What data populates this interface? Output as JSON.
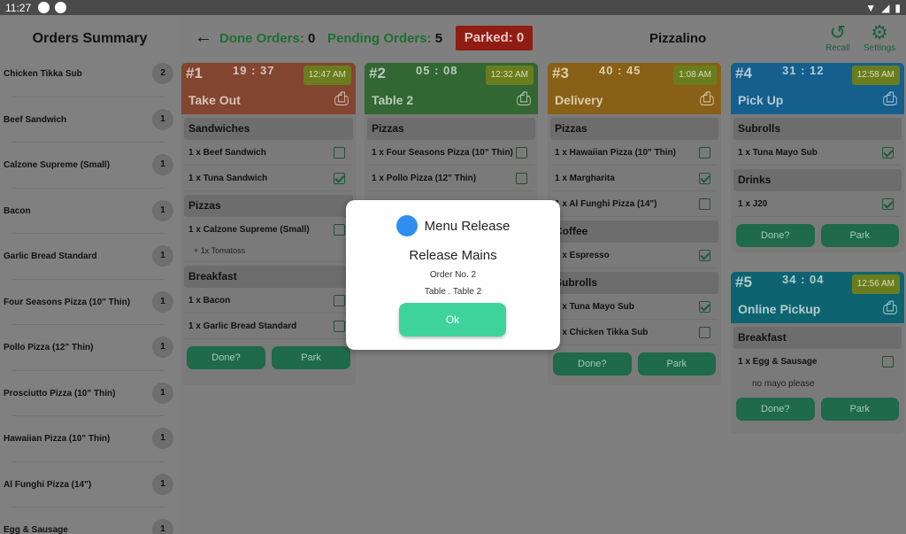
{
  "status_bar": {
    "time": "11:27"
  },
  "sidebar": {
    "title": "Orders Summary",
    "items": [
      {
        "name": "Chicken Tikka Sub",
        "qty": "2"
      },
      {
        "name": "Beef Sandwich",
        "qty": "1"
      },
      {
        "name": "Calzone Supreme (Small)",
        "qty": "1"
      },
      {
        "name": "Bacon",
        "qty": "1"
      },
      {
        "name": "Garlic Bread Standard",
        "qty": "1"
      },
      {
        "name": "Four Seasons Pizza (10\" Thin)",
        "qty": "1"
      },
      {
        "name": "Pollo Pizza (12\" Thin)",
        "qty": "1"
      },
      {
        "name": "Prosciutto Pizza (10\" Thin)",
        "qty": "1"
      },
      {
        "name": "Hawaiian Pizza (10\" Thin)",
        "qty": "1"
      },
      {
        "name": "Al Funghi Pizza (14\")",
        "qty": "1"
      },
      {
        "name": "Egg & Sausage",
        "qty": "1"
      }
    ]
  },
  "header": {
    "done_label": "Done Orders:",
    "done_count": "0",
    "pending_label": "Pending Orders:",
    "pending_count": "5",
    "parked_label": "Parked: 0",
    "store_name": "Pizzalino",
    "recall_label": "Recall",
    "settings_label": "Settings"
  },
  "orders": [
    {
      "num": "#1",
      "timer": "19 : 37",
      "time": "12:47 AM",
      "type": "Take Out",
      "sections": [
        {
          "title": "Sandwiches",
          "rows": [
            "1 x Beef Sandwich",
            "1 x Tuna Sandwich"
          ]
        },
        {
          "title": "Pizzas",
          "rows": [
            "1 x Calzone Supreme (Small)"
          ],
          "modifier": "+ 1x Tomatoss"
        },
        {
          "title": "Breakfast",
          "rows": [
            "1 x Bacon",
            "1 x Garlic Bread Standard"
          ]
        }
      ]
    },
    {
      "num": "#2",
      "timer": "05 : 08",
      "time": "12:32 AM",
      "type": "Table 2",
      "sections": [
        {
          "title": "Pizzas",
          "rows": [
            "1 x Four Seasons Pizza (10\" Thin)",
            "1 x Pollo Pizza (12\" Thin)"
          ]
        }
      ]
    },
    {
      "num": "#3",
      "timer": "40 : 45",
      "time": "1:08 AM",
      "type": "Delivery",
      "sections": [
        {
          "title": "Pizzas",
          "rows": [
            "1 x Hawaiian Pizza (10\" Thin)",
            "1 x Margharita",
            "1 x Al Funghi Pizza (14\")"
          ]
        },
        {
          "title": "Coffee",
          "rows": [
            "1 x Espresso"
          ]
        },
        {
          "title": "Subrolls",
          "rows": [
            "1 x Tuna Mayo Sub",
            "1 x Chicken Tikka Sub"
          ]
        }
      ]
    },
    {
      "num": "#4",
      "timer": "31 : 12",
      "time": "12:58 AM",
      "type": "Pick Up",
      "sections": [
        {
          "title": "Subrolls",
          "rows": [
            "1 x Tuna Mayo Sub"
          ]
        },
        {
          "title": "Drinks",
          "rows": [
            "1 x J20"
          ]
        }
      ]
    },
    {
      "num": "#5",
      "timer": "34 : 04",
      "time": "12:56 AM",
      "type": "Online Pickup",
      "sections": [
        {
          "title": "Breakfast",
          "rows": [
            "1 x Egg & Sausage"
          ],
          "note": "no mayo please"
        }
      ]
    }
  ],
  "buttons": {
    "done": "Done?",
    "park": "Park"
  },
  "dialog": {
    "title": "Menu Release",
    "heading": "Release Mains",
    "order_line": "Order No. 2",
    "table_line": "Table . Table 2",
    "ok": "Ok"
  },
  "colors": {
    "card1": "#82452f",
    "card2": "#326633",
    "card3": "#886018",
    "card4": "#155f8c",
    "card5": "#0d6470"
  }
}
